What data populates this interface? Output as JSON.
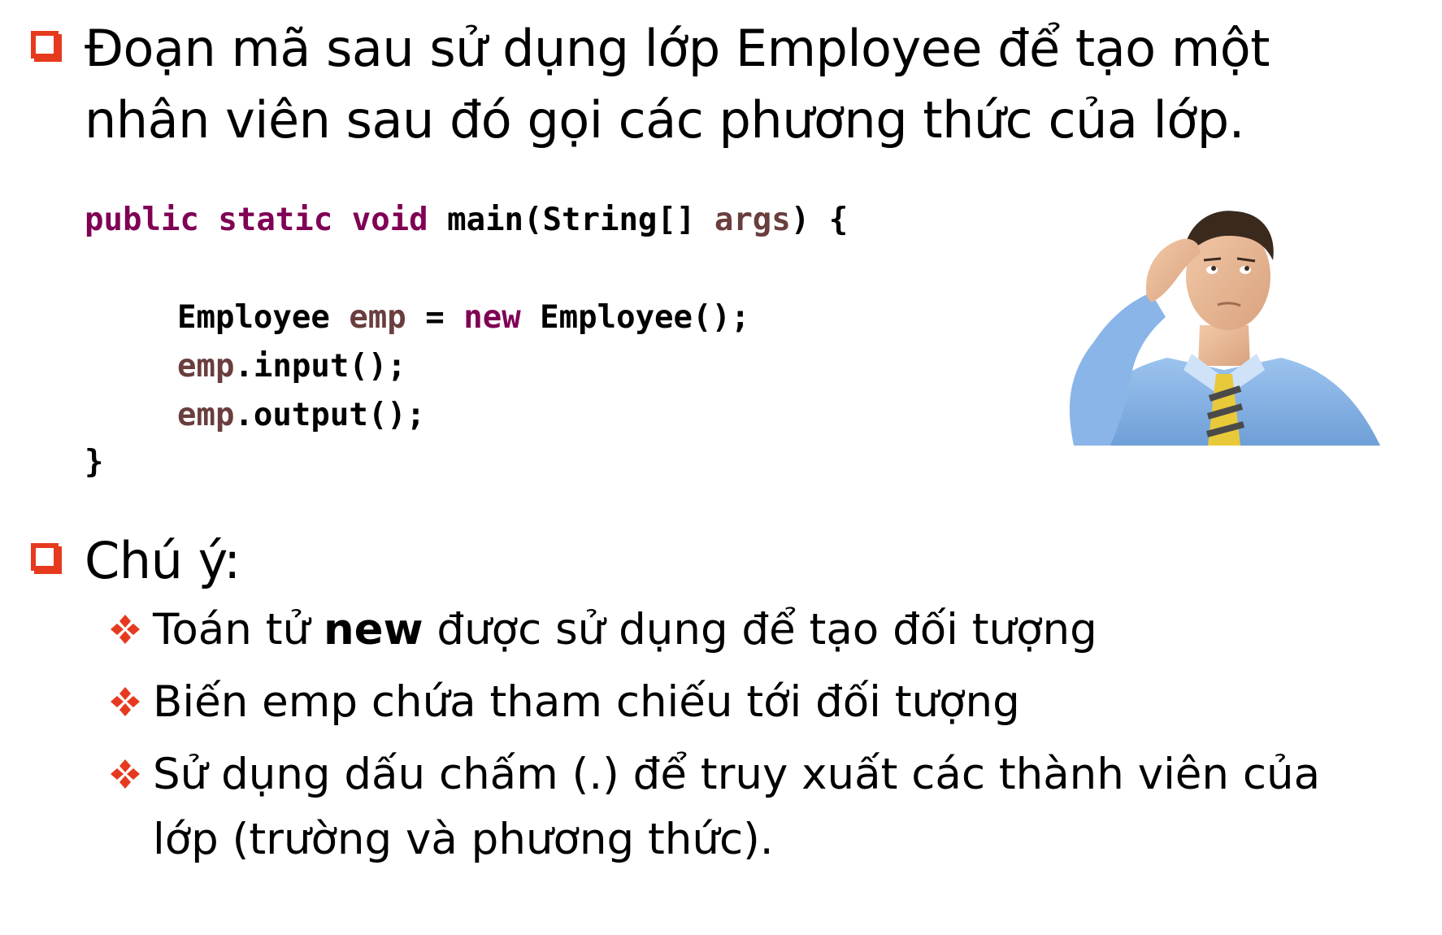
{
  "intro": {
    "line1": "Đoạn mã sau sử dụng lớp Employee để tạo một",
    "line2": "nhân viên sau đó gọi các phương thức của lớp."
  },
  "code": {
    "l1_kw": "public static void",
    "l1_rest": " main(String[] ",
    "l1_var": "args",
    "l1_end": ") {",
    "l2_type": "Employee ",
    "l2_var": "emp",
    "l2_eq": " = ",
    "l2_kw": "new",
    "l2_rest": " Employee();",
    "l3_var": "emp",
    "l3_rest": ".input();",
    "l4_var": "emp",
    "l4_rest": ".output();",
    "l5": "}"
  },
  "note": {
    "heading": "Chú ý:",
    "items": [
      {
        "pre": "Toán tử ",
        "bold": "new",
        "post": " được sử dụng để tạo đối tượng"
      },
      {
        "text": "Biến emp chứa tham chiếu tới đối tượng"
      },
      {
        "line1": "Sử dụng dấu chấm (.) để truy xuất các thành viên của",
        "line2": "lớp (trường và phương thức)."
      }
    ]
  },
  "colors": {
    "accent": "#e63a1e",
    "keyword": "#7f0055",
    "variable": "#6a3e3e"
  },
  "icons": {
    "bullet": "hollow-square-icon",
    "sub_bullet": "four-diamond-icon",
    "figure": "confused-man-illustration"
  }
}
